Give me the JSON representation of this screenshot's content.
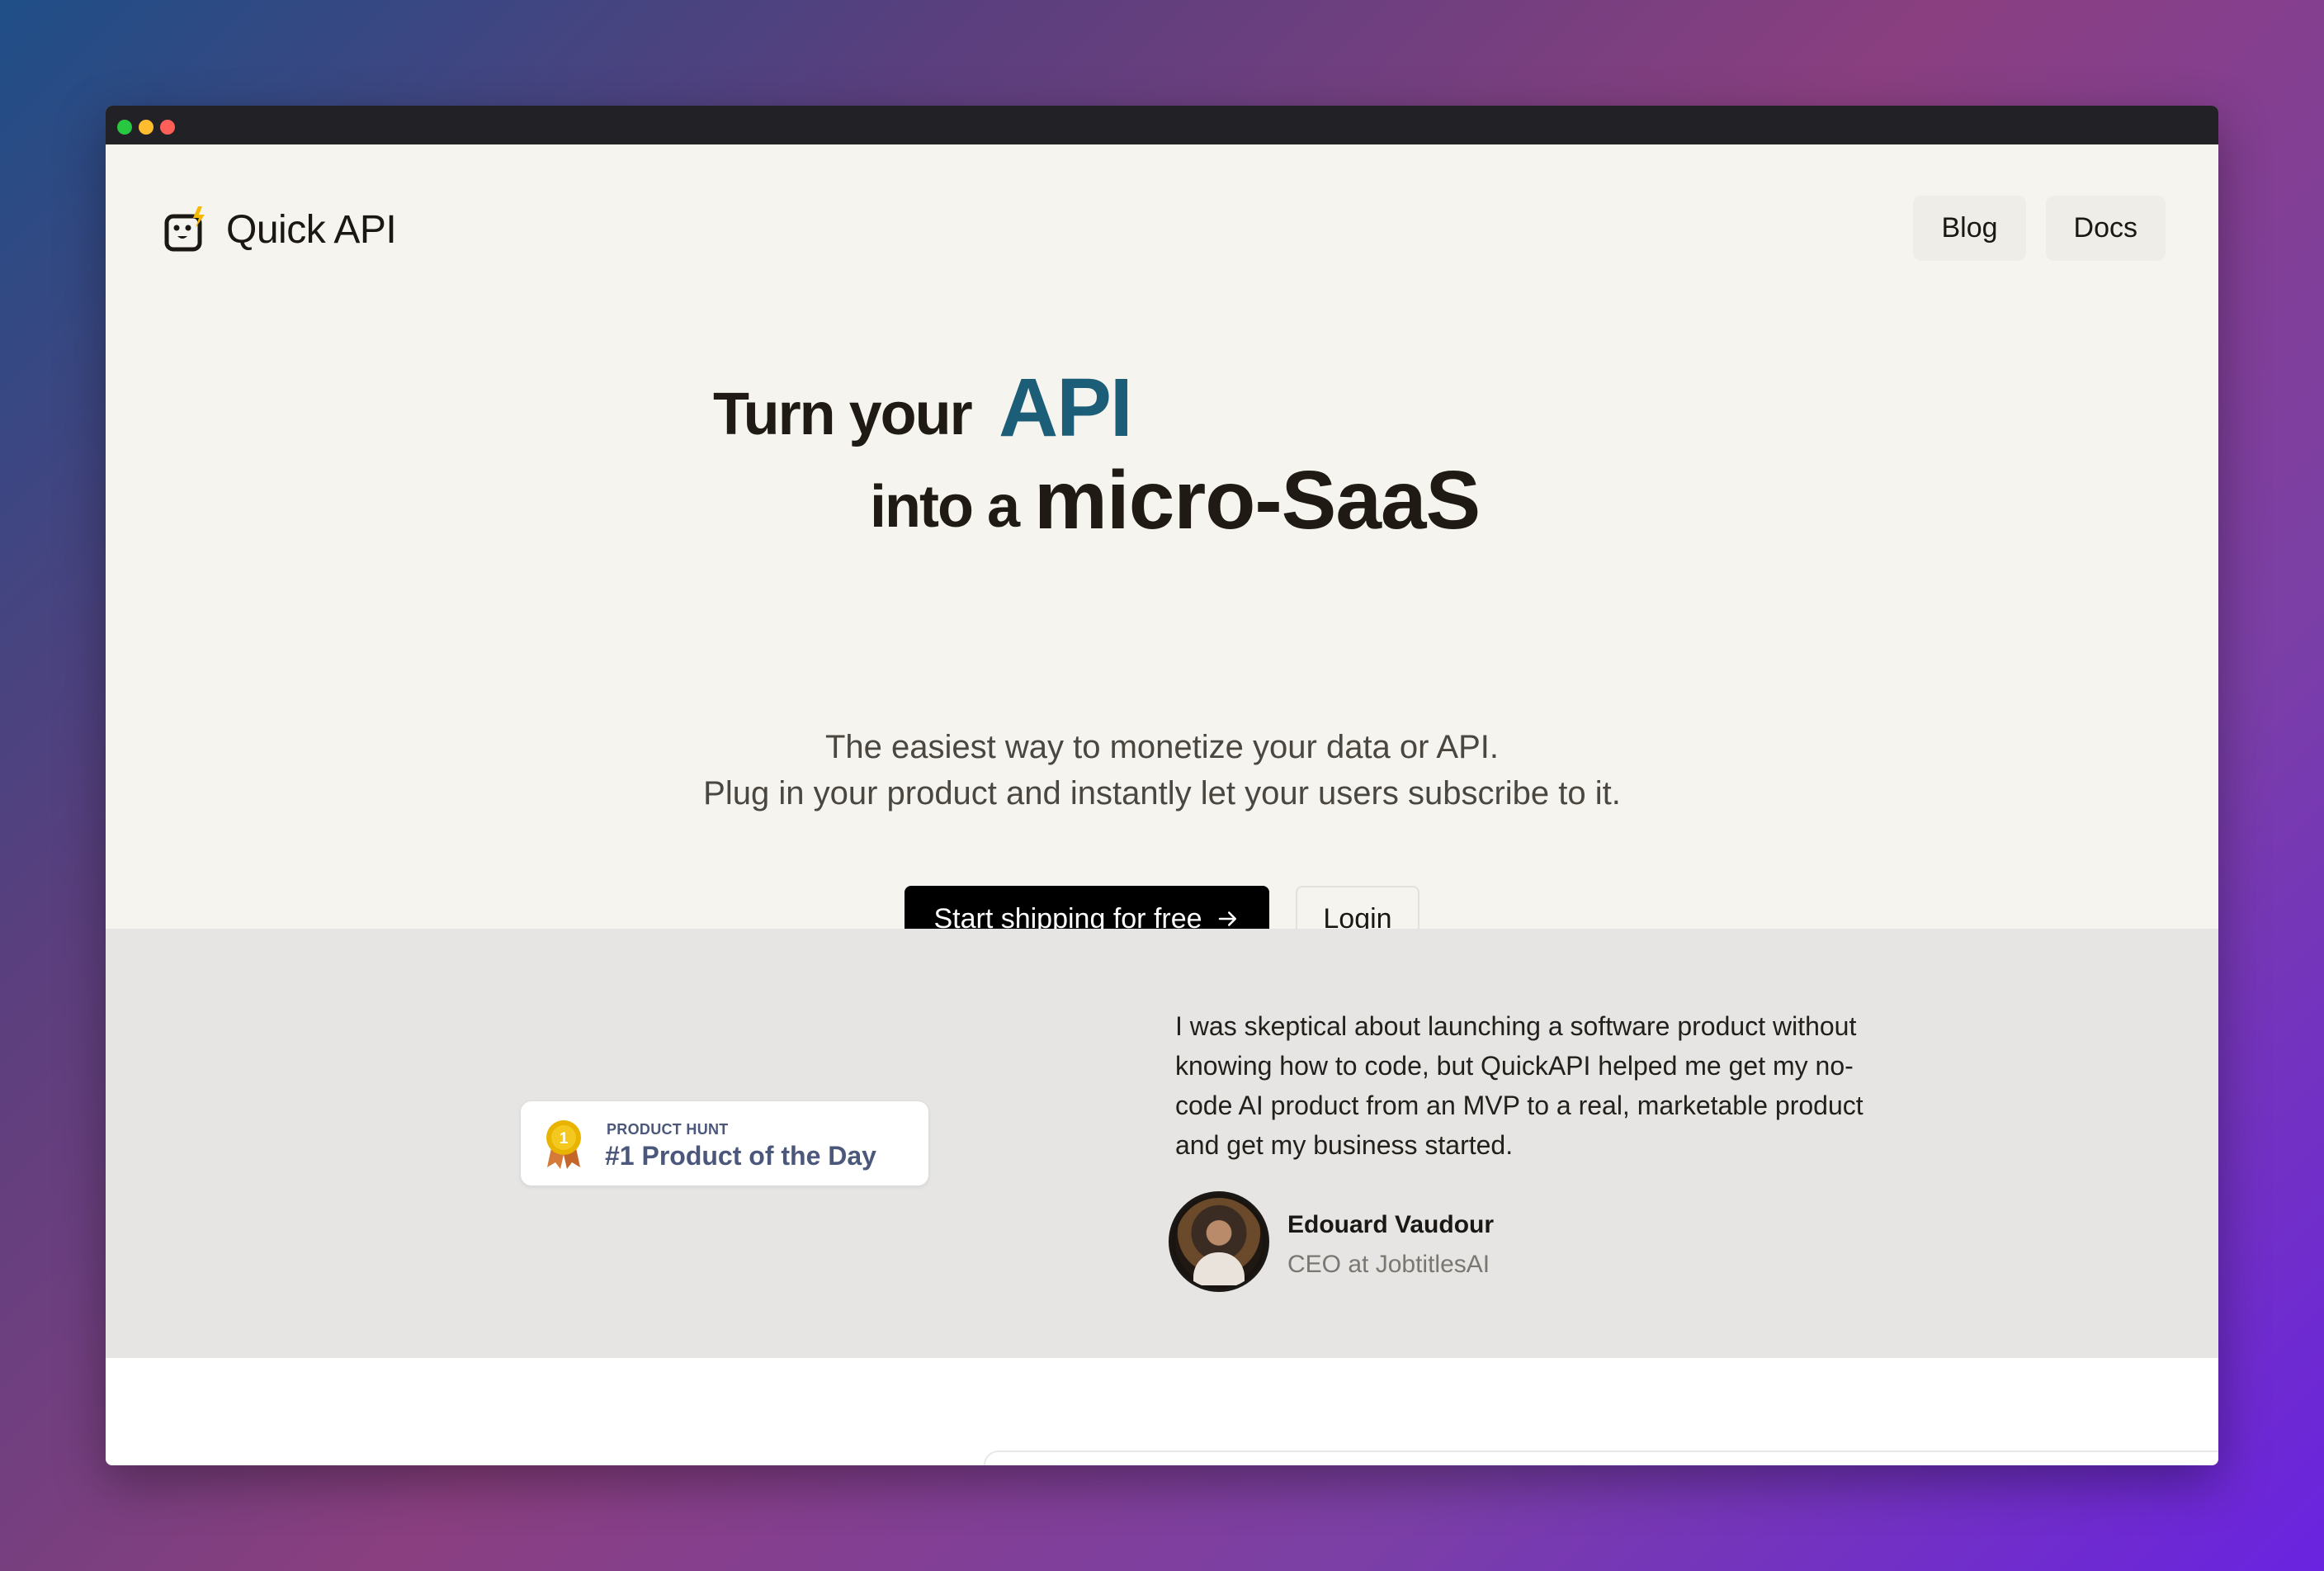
{
  "brand": {
    "name": "Quick API"
  },
  "nav": {
    "items": [
      {
        "label": "Blog"
      },
      {
        "label": "Docs"
      }
    ]
  },
  "hero": {
    "line1_prefix": "Turn your",
    "line1_accent": "API",
    "line2_prefix": "into a",
    "line2_accent": "micro-SaaS",
    "subtitle_line1": "The easiest way to monetize your data or API.",
    "subtitle_line2": "Plug in your product and instantly let your users subscribe to it.",
    "cta_primary": "Start shipping for free",
    "cta_secondary": "Login"
  },
  "badge": {
    "kicker": "PRODUCT HUNT",
    "title": "#1 Product of the Day",
    "rank": "1"
  },
  "testimonial": {
    "quote_lines": [
      "I was skeptical about launching a software product without",
      "knowing how to code, but QuickAPI helped me get my no-",
      "code AI product from an MVP to a real, marketable product",
      "and get my business started."
    ],
    "author_name": "Edouard Vaudour",
    "author_role": "CEO at JobtitlesAI"
  },
  "colors": {
    "accent": "#1c5e78",
    "hero_bg": "#f6f4ee",
    "testimonial_bg": "#e6e5e3",
    "badge_text": "#4b587c"
  }
}
